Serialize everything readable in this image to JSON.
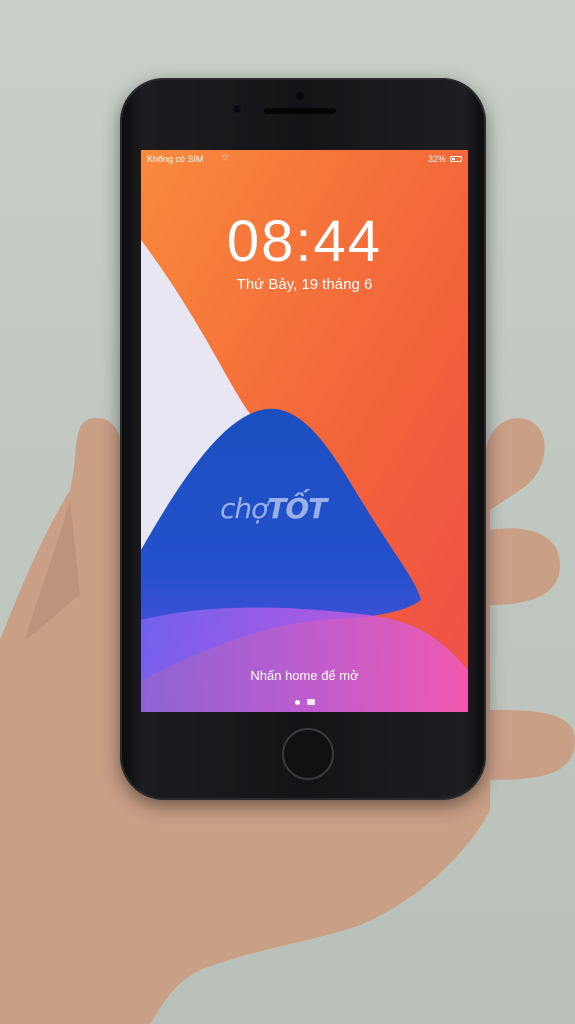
{
  "status_bar": {
    "carrier": "Không có SIM",
    "wifi_icon": "wifi-icon",
    "battery": "32%",
    "battery_icon": "battery-icon"
  },
  "lock_screen": {
    "time": "08:44",
    "date": "Thứ Bảy, 19 tháng 6",
    "unlock_hint": "Nhấn home để mở"
  },
  "page_indicator": {
    "icons": [
      "page-dot-icon",
      "camera-icon"
    ]
  },
  "watermark": {
    "part1": "chợ",
    "part2": "TỐT"
  },
  "colors": {
    "wallpaper_orange": "#f26b3a",
    "wallpaper_blue": "#1d4fc4",
    "wallpaper_white": "#e9e7f2",
    "wallpaper_pink": "#e05bd6",
    "phone_body": "#141417"
  }
}
